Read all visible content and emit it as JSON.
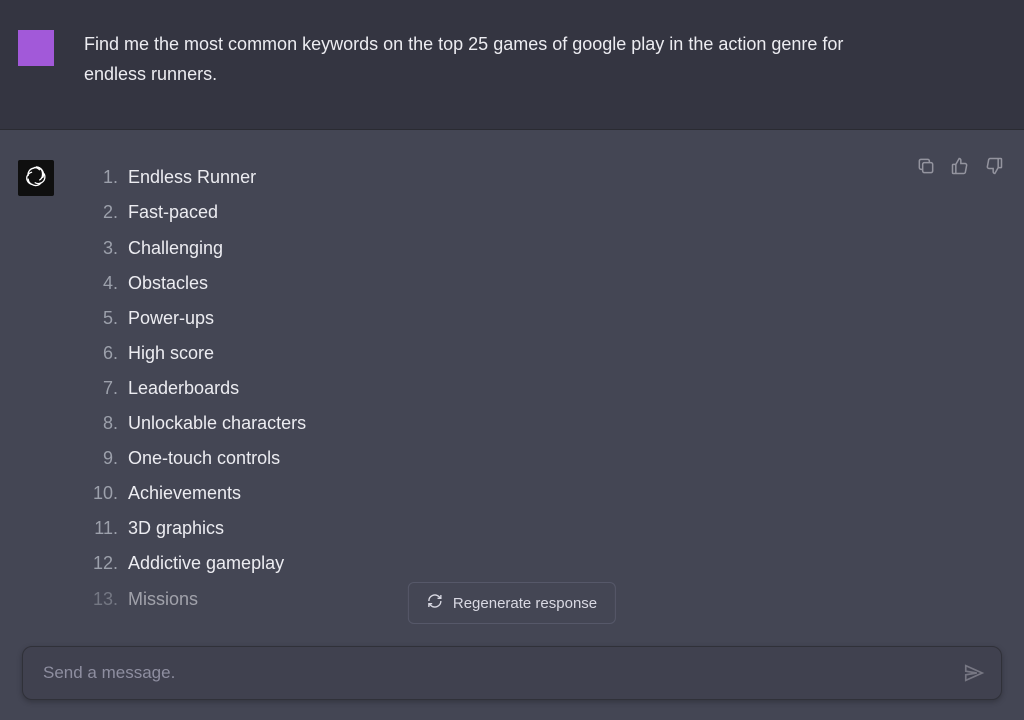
{
  "user": {
    "prompt": "Find me the most common keywords on the top 25 games of google play in the action genre for endless runners."
  },
  "assistant": {
    "keywords": [
      "Endless Runner",
      "Fast-paced",
      "Challenging",
      "Obstacles",
      "Power-ups",
      "High score",
      "Leaderboards",
      "Unlockable characters",
      "One-touch controls",
      "Achievements",
      "3D graphics",
      "Addictive gameplay",
      "Missions"
    ]
  },
  "actions": {
    "regenerate_label": "Regenerate response"
  },
  "input": {
    "placeholder": "Send a message."
  }
}
